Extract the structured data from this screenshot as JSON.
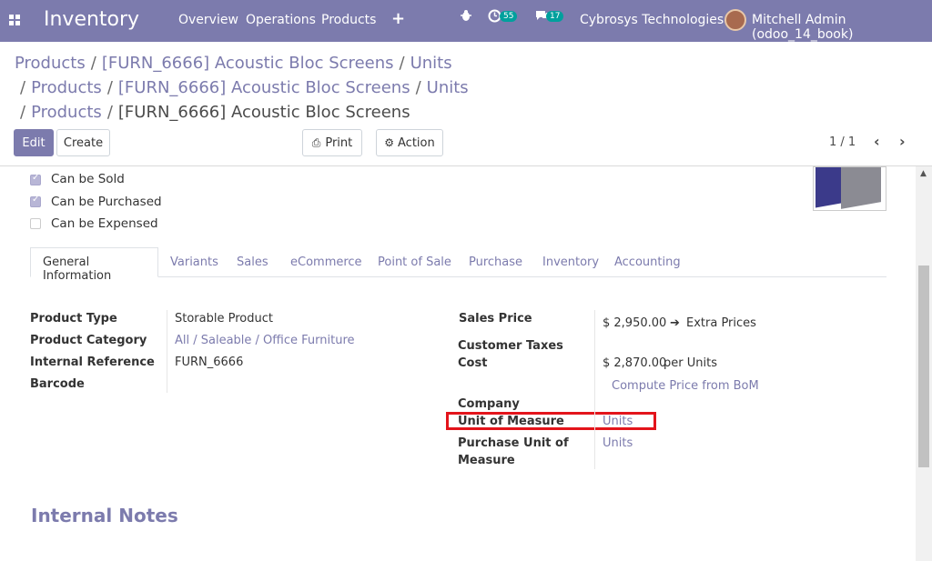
{
  "topbar": {
    "app_name": "Inventory",
    "menu": [
      "Overview",
      "Operations",
      "Products"
    ],
    "plus": "+",
    "activity_count": "55",
    "message_count": "17",
    "company": "Cybrosys Technologies",
    "user": "Mitchell Admin (odoo_14_book)"
  },
  "breadcrumbs": {
    "line1": [
      "Products",
      "[FURN_6666] Acoustic Bloc Screens",
      "Units"
    ],
    "line2": [
      "Products",
      "[FURN_6666] Acoustic Bloc Screens",
      "Units"
    ],
    "line3_links": [
      "Products"
    ],
    "line3_active": "[FURN_6666] Acoustic Bloc Screens"
  },
  "controls": {
    "edit": "Edit",
    "create": "Create",
    "print": "Print",
    "action": "Action",
    "pager": "1 / 1"
  },
  "options": {
    "can_be_sold": {
      "label": "Can be Sold",
      "checked": true
    },
    "can_be_purchased": {
      "label": "Can be Purchased",
      "checked": true
    },
    "can_be_expensed": {
      "label": "Can be Expensed",
      "checked": false
    }
  },
  "tabs": [
    "General Information",
    "Variants",
    "Sales",
    "eCommerce",
    "Point of Sale",
    "Purchase",
    "Inventory",
    "Accounting"
  ],
  "general": {
    "product_type_label": "Product Type",
    "product_type": "Storable Product",
    "product_category_label": "Product Category",
    "product_category": "All / Saleable / Office Furniture",
    "internal_reference_label": "Internal Reference",
    "internal_reference": "FURN_6666",
    "barcode_label": "Barcode",
    "sales_price_label": "Sales Price",
    "sales_price": "$ 2,950.00",
    "extra_prices": "Extra Prices",
    "customer_taxes_label": "Customer Taxes",
    "cost_label": "Cost",
    "cost": "$ 2,870.00",
    "cost_unit": "per Units",
    "compute_bom": "Compute Price from BoM",
    "company_label": "Company",
    "uom_label": "Unit of Measure",
    "uom": "Units",
    "purchase_uom_label_1": "Purchase Unit of",
    "purchase_uom_label_2": "Measure",
    "purchase_uom": "Units"
  },
  "notes": {
    "title": "Internal Notes"
  },
  "colors": {
    "brand": "#7c7bad",
    "highlight": "#e3141b"
  }
}
